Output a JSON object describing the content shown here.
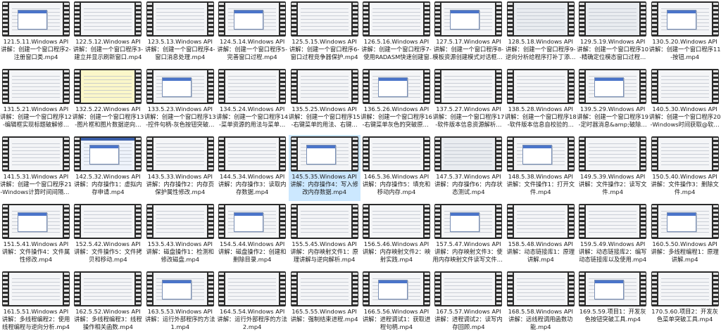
{
  "window": {
    "title": ""
  },
  "selected_index": 24,
  "icon": "video-file-thumbnail-icon",
  "colors": {
    "selection": "#cce8ff",
    "film": "#2b2b2b",
    "text": "#1a1a1a"
  },
  "files": [
    {
      "name": "121.5.11.Windows API 讲解：创建一个窗口程序2-注册窗口类.mp4",
      "tint": "plain"
    },
    {
      "name": "122.5.12.Windows API 讲解：创建一个窗口程序3-建立并显示刷新窗口.mp4",
      "tint": "plain"
    },
    {
      "name": "123.5.13.Windows API 讲解：创建一个窗口程序4-窗口消息处理.mp4",
      "tint": "plain"
    },
    {
      "name": "124.5.14.Windows API 讲解：创建一个窗口程序5-完善窗口过程.mp4",
      "tint": "plain"
    },
    {
      "name": "125.5.15.Windows API 讲解：创建一个窗口程序6-窗口过程竞争器保护.mp4",
      "tint": "plain"
    },
    {
      "name": "126.5.16.Windows API 讲解：创建一个窗口程序7-使用RADASM快速创建窗口.mp4",
      "tint": "plain"
    },
    {
      "name": "127.5.17.Windows API 讲解：创建一个窗口程序8-模板资源创建模式对话框.mp4",
      "tint": "plain"
    },
    {
      "name": "128.5.18.Windows API 讲解：创建一个窗口程序9-逆向分析给程序打补丁添加功能.mp4",
      "tint": "dark"
    },
    {
      "name": "129.5.19.Windows API 讲解：创建一个窗口程序10-精确定位模态窗口过程函数.mp4",
      "tint": "dark"
    },
    {
      "name": "130.5.20.Windows API 讲解：创建一个窗口程序11-按钮.mp4",
      "tint": "plain"
    },
    {
      "name": "131.5.21.Windows API 讲解：创建一个窗口程序12-编辑框实现标题破解修改工具.mp4",
      "tint": "plain"
    },
    {
      "name": "132.5.22.Windows API 讲解：创建一个窗口程序13-图片框和图片数据逆向分析.mp4",
      "tint": "yellow"
    },
    {
      "name": "133.5.23.Windows API 讲解：创建一个窗口程序13-控件句柄-灰色按钮突破工具.mp4",
      "tint": "plain"
    },
    {
      "name": "134.5.24.Windows API 讲解：创建一个窗口程序14-菜单资源的用法与菜单破解修改.mp4",
      "tint": "plain"
    },
    {
      "name": "135.5.25.Windows API 讲解：创建一个窗口程序15-右键菜单的用法、右键菜单灰色原理.mp4",
      "tint": "plain"
    },
    {
      "name": "136.5.26.Windows API 讲解：创建一个窗口程序16-右键菜单灰色的突破原理.mp4",
      "tint": "plain"
    },
    {
      "name": "137.5.27.Windows API 讲解：创建一个窗口程序17-软件版本信息资源解析修改.mp4",
      "tint": "plain"
    },
    {
      "name": "138.5.28.Windows API 讲解：创建一个窗口程序18-软件版本信息自校验的破解绕过.mp4",
      "tint": "plain"
    },
    {
      "name": "139.5.29.Windows API 讲解：创建一个窗口程序19-定时器消息&amp;破除软件限制器环境检测.mp4",
      "tint": "plain"
    },
    {
      "name": "140.5.30.Windows API 讲解：创建一个窗口程序20-Windows时间获取@软件时间限制思路.mp4",
      "tint": "plain"
    },
    {
      "name": "141.5.31.Windows API 讲解：创建一个窗口程序21-Windows计算时间间隔&amp;本地软件试用的…",
      "tint": "plain"
    },
    {
      "name": "142.5.32.Windows API 讲解：内存操作1：虚拟内存申请.mp4",
      "tint": "blue"
    },
    {
      "name": "143.5.33.Windows API 讲解：内存操作2：内存页保护属性修改.mp4",
      "tint": "plain"
    },
    {
      "name": "144.5.34.Windows API 讲解：内存操作3：读取内存数据.mp4",
      "tint": "plain"
    },
    {
      "name": "145.5.35.Windows API 讲解：内存操作4：写入修改内存数据.mp4",
      "tint": "plain"
    },
    {
      "name": "146.5.36.Windows API 讲解：内存操作5：填充和移动内存.mp4",
      "tint": "plain"
    },
    {
      "name": "147.5.37.Windows API 讲解：内存操作6：内存状态测试.mp4",
      "tint": "dark"
    },
    {
      "name": "148.5.38.Windows API 讲解：文件操作1：打开文件.mp4",
      "tint": "plain"
    },
    {
      "name": "149.5.39.Windows API 讲解：文件操作2：读写文件.mp4",
      "tint": "plain"
    },
    {
      "name": "150.5.40.Windows API 讲解：文件操作3：删除文件.mp4",
      "tint": "plain"
    },
    {
      "name": "151.5.41.Windows API 讲解：文件操作4：文件属性修改.mp4",
      "tint": "plain"
    },
    {
      "name": "152.5.42.Windows API 讲解：文件操作5：文件拷贝和移动.mp4",
      "tint": "plain"
    },
    {
      "name": "153.5.43.Windows API 讲解：磁盘操作1：检测和修改磁盘.mp4",
      "tint": "plain"
    },
    {
      "name": "154.5.44.Windows API 讲解：磁盘操作2：创建和删除目录.mp4",
      "tint": "plain"
    },
    {
      "name": "155.5.45.Windows API 讲解：内存映射文件1：原理讲解与逆向解析.mp4",
      "tint": "plain"
    },
    {
      "name": "156.5.46.Windows API 讲解：内存映射文件2：映射实践.mp4",
      "tint": "plain"
    },
    {
      "name": "157.5.47.Windows API 讲解：内存映射文件3：使用内存映射文件读写文件.mp4",
      "tint": "plain"
    },
    {
      "name": "158.5.48.Windows API 讲解：动态链接库1：原理讲解.mp4",
      "tint": "plain"
    },
    {
      "name": "159.5.49.Windows API 讲解：动态链接库2：编写动态链接库以及使用.mp4",
      "tint": "plain"
    },
    {
      "name": "160.5.50.Windows API 讲解：多线程编程1：原理讲解.mp4",
      "tint": "plain"
    },
    {
      "name": "161.5.51.Windows API 讲解：多线程编程2：使用线程编程与逆向分析.mp4",
      "tint": "plain"
    },
    {
      "name": "162.5.52.Windows API 讲解：多线程编程3：线程操作相关函数.mp4",
      "tint": "plain"
    },
    {
      "name": "163.5.53.Windows API 讲解：运行外部程序的方法1.mp4",
      "tint": "plain"
    },
    {
      "name": "164.5.54.Windows API 讲解：运行外部程序的方法2.mp4",
      "tint": "plain"
    },
    {
      "name": "165.5.55.Windows API 讲解：强制结束进程.mp4",
      "tint": "plain"
    },
    {
      "name": "166.5.56.Windows API 讲解：进程调试1：获取进程句柄.mp4",
      "tint": "plain"
    },
    {
      "name": "167.5.57.Windows API 讲解：进程调试2：读写内存回顾.mp4",
      "tint": "plain"
    },
    {
      "name": "168.5.58.Windows API 讲解：远线程调用函数功能.mp4",
      "tint": "plain"
    },
    {
      "name": "169.5.59.项目1：开发灰色按钮突破工具.mp4",
      "tint": "plain"
    },
    {
      "name": "170.5.60.项目2：开发灰色菜单突破工具.mp4",
      "tint": "plain"
    }
  ]
}
